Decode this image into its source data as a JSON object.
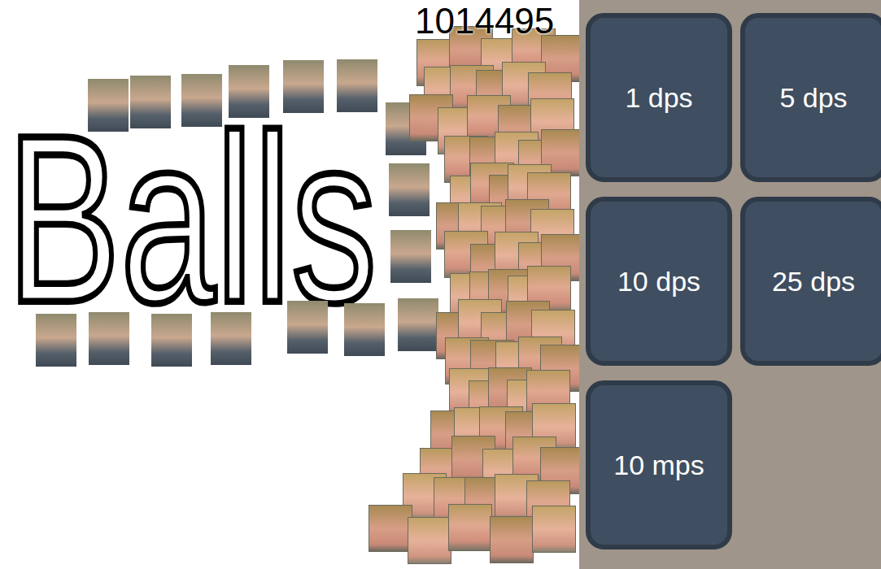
{
  "counter": "1014495",
  "title": "Balls",
  "upgrades": [
    {
      "label": "1 dps"
    },
    {
      "label": "5 dps"
    },
    {
      "label": "10 dps"
    },
    {
      "label": "25 dps"
    },
    {
      "label": "10 mps"
    }
  ]
}
